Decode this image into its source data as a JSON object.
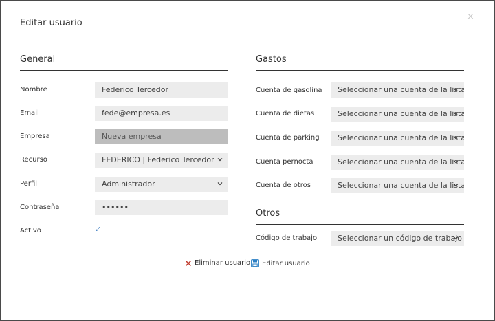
{
  "dialog": {
    "title": "Editar usuario",
    "close_glyph": "×"
  },
  "general": {
    "section_title": "General",
    "fields": {
      "nombre": {
        "label": "Nombre",
        "value": "Federico Tercedor"
      },
      "email": {
        "label": "Email",
        "value": "fede@empresa.es"
      },
      "empresa": {
        "label": "Empresa",
        "value": "Nueva empresa"
      },
      "recurso": {
        "label": "Recurso",
        "value": "FEDERICO | Federico Tercedor"
      },
      "perfil": {
        "label": "Perfil",
        "value": "Administrador"
      },
      "contrasena": {
        "label": "Contraseña",
        "value": "••••••"
      },
      "activo": {
        "label": "Activo",
        "checked": true,
        "check_glyph": "✓"
      }
    }
  },
  "gastos": {
    "section_title": "Gastos",
    "fields": [
      {
        "label": "Cuenta de gasolina",
        "value": "Seleccionar una cuenta de la lista"
      },
      {
        "label": "Cuenta de dietas",
        "value": "Seleccionar una cuenta de la lista"
      },
      {
        "label": "Cuenta de parking",
        "value": "Seleccionar una cuenta de la lista"
      },
      {
        "label": "Cuenta pernocta",
        "value": "Seleccionar una cuenta de la lista"
      },
      {
        "label": "Cuenta de otros",
        "value": "Seleccionar una cuenta de la lista"
      }
    ]
  },
  "otros": {
    "section_title": "Otros",
    "codigo_trabajo": {
      "label": "Código de trabajo",
      "value": "Seleccionar un código de trabajo"
    }
  },
  "actions": {
    "delete_label": "Eliminar usuario",
    "edit_label": "Editar usuario"
  },
  "icons": {
    "chevron": "chevron-down-icon",
    "delete": "x-icon",
    "save": "floppy-disk-icon"
  },
  "colors": {
    "delete_icon": "#c0392b",
    "save_icon": "#2a7fc4",
    "check": "#3a7ac0"
  }
}
